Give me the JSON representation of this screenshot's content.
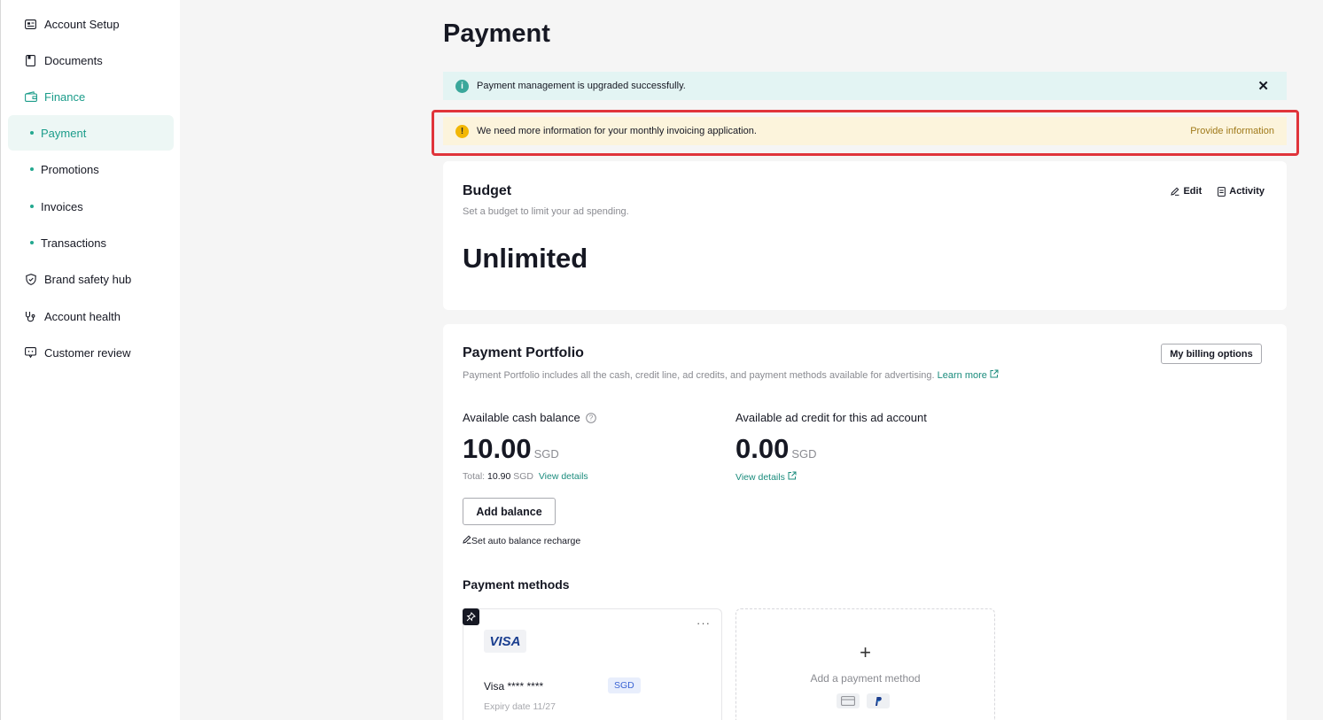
{
  "sidebar": {
    "items": [
      {
        "label": "Account Setup",
        "icon": "id-card-icon"
      },
      {
        "label": "Documents",
        "icon": "document-icon"
      },
      {
        "label": "Finance",
        "icon": "wallet-icon"
      },
      {
        "label": "Payment"
      },
      {
        "label": "Promotions"
      },
      {
        "label": "Invoices"
      },
      {
        "label": "Transactions"
      },
      {
        "label": "Brand safety hub",
        "icon": "shield-icon"
      },
      {
        "label": "Account health",
        "icon": "stethoscope-icon"
      },
      {
        "label": "Customer review",
        "icon": "review-icon"
      }
    ]
  },
  "page": {
    "title": "Payment"
  },
  "banners": {
    "info_text": "Payment management is upgraded successfully.",
    "info_close": "✕",
    "warn_text": "We need more information for your monthly invoicing application.",
    "warn_action": "Provide information"
  },
  "budget": {
    "title": "Budget",
    "subtitle": "Set a budget to limit your ad spending.",
    "edit_label": "Edit",
    "activity_label": "Activity",
    "value": "Unlimited"
  },
  "portfolio": {
    "title": "Payment Portfolio",
    "subtitle": "Payment Portfolio includes all the cash, credit line, ad credits, and payment methods available for advertising.",
    "learn_more": "Learn more",
    "billing_button": "My billing options",
    "cash": {
      "label": "Available cash balance",
      "value": "10.00",
      "unit": "SGD",
      "total_prefix": "Total:",
      "total_value": "10.90",
      "total_unit": "SGD",
      "view_details": "View details"
    },
    "credit": {
      "label": "Available ad credit for this ad account",
      "value": "0.00",
      "unit": "SGD",
      "view_details": "View details"
    },
    "add_balance": "Add balance",
    "auto_recharge": "Set auto balance recharge",
    "methods_title": "Payment methods",
    "visa": {
      "brand": "VISA",
      "number": "Visa **** ****",
      "currency": "SGD",
      "expiry": "Expiry date 11/27",
      "menu": "···"
    },
    "add_method": {
      "plus": "+",
      "label": "Add a payment method"
    }
  },
  "colors": {
    "accent": "#1b9c8a",
    "warning_bg": "#fcf4dc",
    "info_bg": "#e3f4f3",
    "highlight": "#e0343b"
  }
}
